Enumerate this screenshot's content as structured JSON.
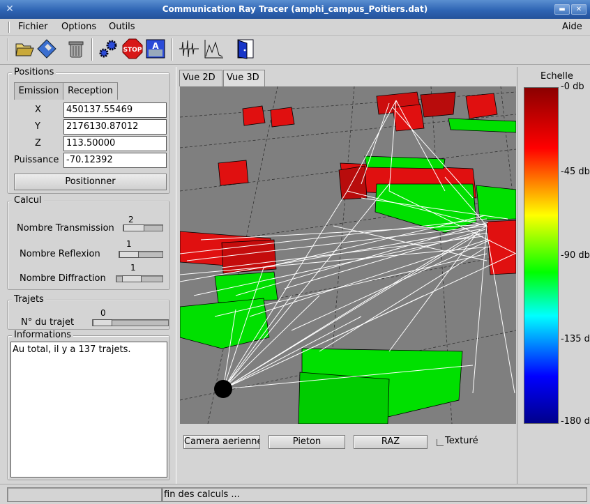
{
  "window": {
    "title": "Communication Ray Tracer  (amphi_campus_Poitiers.dat)"
  },
  "menu": {
    "items": [
      "Fichier",
      "Options",
      "Outils"
    ],
    "help": "Aide"
  },
  "toolbar": {
    "icons": [
      "open-folder-icon",
      "save-disk-icon",
      "trash-icon",
      "gears-icon",
      "stop-icon",
      "text-icon",
      "signal-icon",
      "graph-icon",
      "exit-door-icon"
    ],
    "stop_text": "STOP"
  },
  "positions": {
    "legend": "Positions",
    "tabs": [
      "Emission",
      "Reception"
    ],
    "fields": [
      {
        "label": "X",
        "value": "450137.55469"
      },
      {
        "label": "Y",
        "value": "2176130.87012"
      },
      {
        "label": "Z",
        "value": "113.50000"
      },
      {
        "label": "Puissance",
        "value": "-70.12392"
      }
    ],
    "button": "Positionner"
  },
  "calcul": {
    "legend": "Calcul",
    "sliders": [
      {
        "label": "Nombre Transmission",
        "value": "2"
      },
      {
        "label": "Nombre Reflexion",
        "value": "1"
      },
      {
        "label": "Nombre Diffraction",
        "value": "1"
      }
    ]
  },
  "trajets": {
    "legend": "Trajets",
    "label": "N° du trajet",
    "value": "0"
  },
  "informations": {
    "legend": "Informations",
    "text": "Au total, il y a 137 trajets."
  },
  "view": {
    "tabs": [
      "Vue 2D",
      "Vue 3D"
    ],
    "buttons": [
      "Camera aerienne",
      "Pieton",
      "RAZ"
    ],
    "checkbox": "Texturé"
  },
  "scale": {
    "title": "Echelle",
    "labels": [
      "-0 db",
      "-45 db",
      "-90 db",
      "-135 d",
      "-180 d"
    ],
    "colors": [
      "#8b0000",
      "#ff0000",
      "#ffff00",
      "#00ff00",
      "#00ffff",
      "#0000ff",
      "#00008b"
    ]
  },
  "status": {
    "left": "",
    "message": "fin des calculs ..."
  }
}
